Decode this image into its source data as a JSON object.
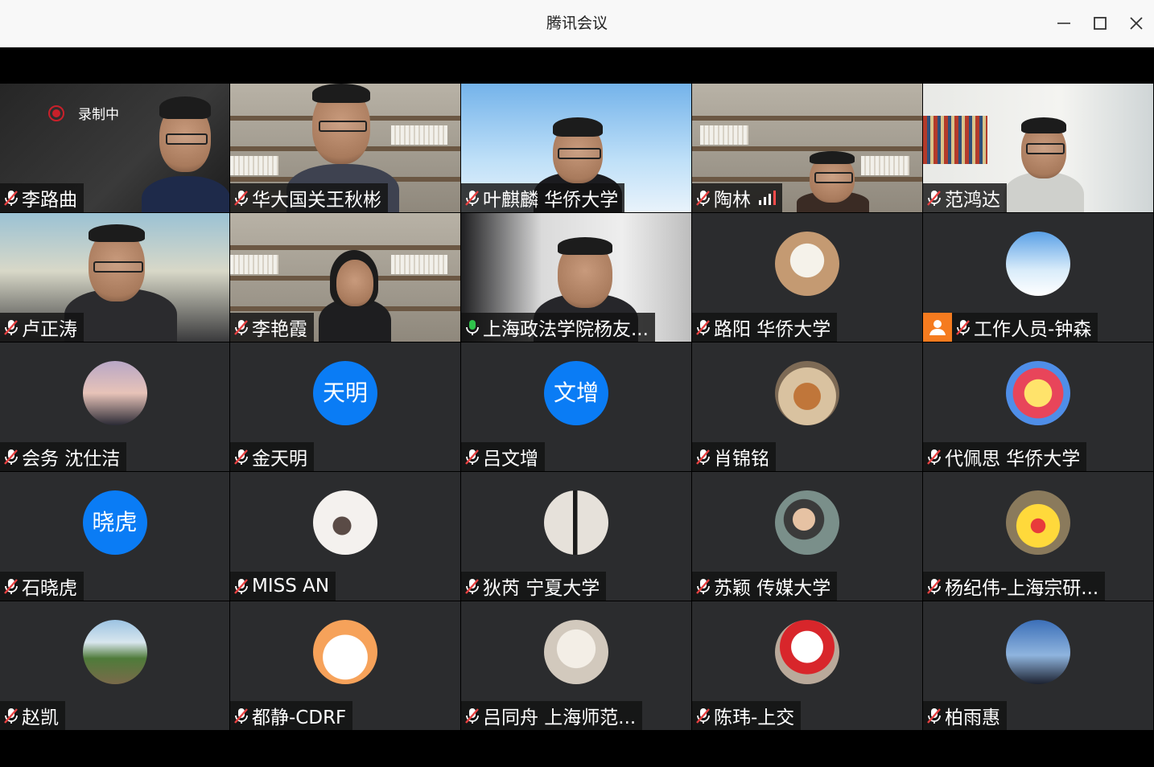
{
  "window": {
    "title": "腾讯会议"
  },
  "recording": {
    "label": "录制中"
  },
  "participants": [
    {
      "name": "李路曲",
      "mic": "muted",
      "kind": "video"
    },
    {
      "name": "华大国关王秋彬",
      "mic": "muted",
      "kind": "video"
    },
    {
      "name": "叶麒麟 华侨大学",
      "mic": "muted",
      "kind": "video"
    },
    {
      "name": "陶林",
      "mic": "muted",
      "kind": "video"
    },
    {
      "name": "范鸿达",
      "mic": "muted",
      "kind": "video"
    },
    {
      "name": "卢正涛",
      "mic": "muted",
      "kind": "video"
    },
    {
      "name": "李艳霞",
      "mic": "muted",
      "kind": "video"
    },
    {
      "name": "上海政法学院杨友...",
      "mic": "active",
      "kind": "video"
    },
    {
      "name": "路阳 华侨大学",
      "mic": "muted",
      "kind": "avatar"
    },
    {
      "name": "工作人员-钟森",
      "mic": "muted",
      "kind": "avatar"
    },
    {
      "name": "会务 沈仕洁",
      "mic": "muted",
      "kind": "avatar"
    },
    {
      "name": "金天明",
      "mic": "muted",
      "kind": "avatar",
      "avatar_text": "天明"
    },
    {
      "name": "吕文增",
      "mic": "muted",
      "kind": "avatar",
      "avatar_text": "文增"
    },
    {
      "name": "肖锦铭",
      "mic": "muted",
      "kind": "avatar"
    },
    {
      "name": "代佩思 华侨大学",
      "mic": "muted",
      "kind": "avatar"
    },
    {
      "name": "石晓虎",
      "mic": "muted",
      "kind": "avatar",
      "avatar_text": "晓虎"
    },
    {
      "name": "MISS AN",
      "mic": "muted",
      "kind": "avatar"
    },
    {
      "name": "狄芮 宁夏大学",
      "mic": "muted",
      "kind": "avatar"
    },
    {
      "name": "苏颖 传媒大学",
      "mic": "muted",
      "kind": "avatar"
    },
    {
      "name": "杨纪伟-上海宗研...",
      "mic": "muted",
      "kind": "avatar"
    },
    {
      "name": "赵凯",
      "mic": "muted",
      "kind": "avatar"
    },
    {
      "name": "都静-CDRF",
      "mic": "muted",
      "kind": "avatar"
    },
    {
      "name": "吕同舟 上海师范...",
      "mic": "muted",
      "kind": "avatar"
    },
    {
      "name": "陈玮-上交",
      "mic": "muted",
      "kind": "avatar"
    },
    {
      "name": "柏雨惠",
      "mic": "muted",
      "kind": "avatar"
    }
  ],
  "colors": {
    "tile_bg": "#2b2c2e",
    "muted_mic": "#e84141",
    "active_mic": "#2fc24b",
    "avatar_blue": "#0a7cf5",
    "staff_badge": "#f57b1f",
    "record_red": "#c9202a"
  }
}
